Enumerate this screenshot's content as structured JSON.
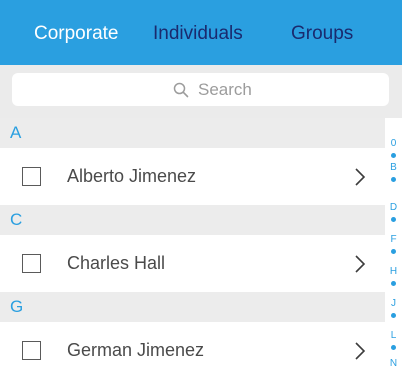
{
  "header": {
    "background": "#2a9fe0",
    "tabs": [
      {
        "label": "Corporate",
        "active": true,
        "color": "#ffffff"
      },
      {
        "label": "Individuals",
        "active": false,
        "color": "#1a2a6e"
      },
      {
        "label": "Groups",
        "active": false,
        "color": "#1a2a6e"
      }
    ]
  },
  "search": {
    "placeholder": "Search",
    "icon": "search-icon"
  },
  "sections": [
    {
      "letter": "A",
      "contacts": [
        {
          "name": "Alberto Jimenez",
          "checked": false
        }
      ]
    },
    {
      "letter": "C",
      "contacts": [
        {
          "name": "Charles Hall",
          "checked": false
        }
      ]
    },
    {
      "letter": "G",
      "contacts": [
        {
          "name": "German Jimenez",
          "checked": false
        }
      ]
    }
  ],
  "index": {
    "letters": [
      "0",
      "B",
      "D",
      "F",
      "H",
      "J",
      "L",
      "N"
    ],
    "accent": "#2a9fe0"
  }
}
